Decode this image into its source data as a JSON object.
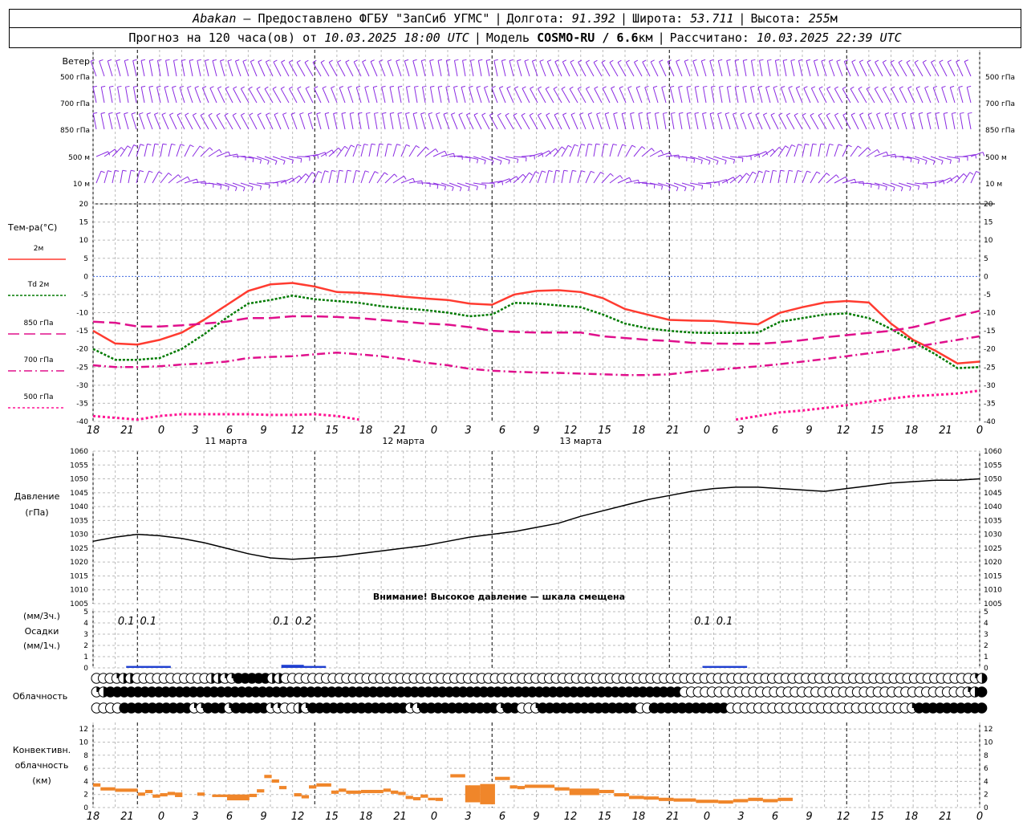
{
  "header": {
    "station": "Abakan",
    "provider": "— Предоставлено ФГБУ \"ЗапСиб УГМС\"",
    "lon_label": "Долгота:",
    "lon": "91.392",
    "lat_label": "Широта:",
    "lat": "53.711",
    "alt_label": "Высота:",
    "alt": "255",
    "alt_unit": "м",
    "forecast_prefix": "Прогноз на 120 часа(ов) от",
    "forecast_start": "10.03.2025 18:00 UTC",
    "model_label": "Модель",
    "model": "COSMO-RU / 6.6",
    "model_unit": "км",
    "computed_label": "Рассчитано:",
    "computed": "10.03.2025 22:39 UTC"
  },
  "wind_panel": {
    "title": "Ветер",
    "levels": [
      "500 гПа",
      "700 гПа",
      "850 гПа",
      "500 м",
      "10  м"
    ],
    "barb_color": "#8a2be2"
  },
  "temp_panel": {
    "title": "Тем-ра(°C)",
    "legend": [
      {
        "label": "2м",
        "color": "#ff3b30",
        "dash": ""
      },
      {
        "label": "Td  2м",
        "color": "#007a00",
        "dash": "3,2"
      },
      {
        "label": "850 гПа",
        "color": "#e0108c",
        "dash": "14,6"
      },
      {
        "label": "700 гПа",
        "color": "#e0108c",
        "dash": "10,4,2,4"
      },
      {
        "label": "500 гПа",
        "color": "#ff1493",
        "dash": "3,3"
      }
    ],
    "y_ticks": [
      "20",
      "15",
      "10",
      "5",
      "0",
      "-5",
      "-10",
      "-15",
      "-20",
      "-25",
      "-30",
      "-35",
      "-40"
    ]
  },
  "x_axis": {
    "hours": [
      "18",
      "21",
      "0",
      "3",
      "6",
      "9",
      "12",
      "15",
      "18",
      "21",
      "0",
      "3",
      "6",
      "9",
      "12",
      "15",
      "18",
      "21",
      "0",
      "3",
      "6",
      "9",
      "12",
      "15",
      "18",
      "21",
      "0"
    ],
    "days": [
      "11 марта",
      "12 марта",
      "13 марта"
    ]
  },
  "pressure_panel": {
    "title": "Давление",
    "unit": "(гПа)",
    "warning": "Внимание! Высокое давление — шкала смещена",
    "y_ticks": [
      "1060",
      "1055",
      "1050",
      "1045",
      "1040",
      "1035",
      "1030",
      "1025",
      "1020",
      "1015",
      "1010",
      "1005"
    ]
  },
  "precip_panel": {
    "unit3": "(мм/3ч.)",
    "title": "Осадки",
    "unit1": "(мм/1ч.)",
    "y_ticks": [
      "5",
      "4",
      "3",
      "2",
      "1",
      "0"
    ],
    "labels": [
      "0.1",
      "0.1",
      "0.1",
      "0.2",
      "0.1",
      "0.1",
      "0.1"
    ]
  },
  "cloud_panel": {
    "title": "Облачность"
  },
  "conv_panel": {
    "title": "Конвективн.",
    "title2": "облачность",
    "unit": "(км)",
    "y_ticks": [
      "12",
      "10",
      "8",
      "6",
      "4",
      "2",
      "0"
    ]
  },
  "chart_data": [
    {
      "type": "line",
      "title": "Тем-ра(°C)",
      "ylim": [
        -40,
        20
      ],
      "x_hours": [
        0,
        3,
        6,
        9,
        12,
        15,
        18,
        21,
        24,
        27,
        30,
        33,
        36,
        39,
        42,
        45,
        48,
        51,
        54,
        57,
        60,
        63,
        66,
        69,
        72,
        75,
        78,
        81,
        84,
        87,
        90,
        93,
        96,
        99,
        102,
        105,
        108,
        111,
        114,
        117,
        120
      ],
      "series": [
        {
          "name": "2м",
          "values": [
            -15,
            -18.5,
            -18.8,
            -17.5,
            -15.5,
            -12,
            -8,
            -4,
            -2.2,
            -1.8,
            -2.8,
            -4.3,
            -4.5,
            -5,
            -5.6,
            -6.1,
            -6.5,
            -7.5,
            -7.8,
            -5,
            -4,
            -3.8,
            -4.3,
            -6,
            -9,
            -10.5,
            -12,
            -12.2,
            -12.3,
            -12.8,
            -13.2,
            -10,
            -8.5,
            -7.2,
            -6.8,
            -7.2,
            -13,
            -17.5,
            -20.5,
            -24,
            -23.5
          ]
        },
        {
          "name": "Td  2м",
          "values": [
            -20,
            -23,
            -23,
            -22.5,
            -20,
            -16,
            -11.5,
            -7.5,
            -6.5,
            -5.3,
            -6.3,
            -6.8,
            -7.3,
            -8.2,
            -8.8,
            -9.3,
            -10,
            -11,
            -10.5,
            -7.3,
            -7.5,
            -8,
            -8.5,
            -10.5,
            -13,
            -14.3,
            -15,
            -15.5,
            -15.6,
            -15.6,
            -15.5,
            -12.5,
            -11.5,
            -10.5,
            -10.2,
            -11.5,
            -14.5,
            -18,
            -21.5,
            -25.3,
            -25
          ]
        },
        {
          "name": "850 гПа",
          "values": [
            -12.5,
            -12.8,
            -13.8,
            -13.8,
            -13.5,
            -13,
            -12.5,
            -11.5,
            -11.5,
            -11,
            -11,
            -11.2,
            -11.5,
            -12,
            -12.5,
            -13,
            -13.3,
            -14,
            -15,
            -15.3,
            -15.5,
            -15.5,
            -15.5,
            -16.5,
            -17,
            -17.5,
            -17.8,
            -18.3,
            -18.5,
            -18.6,
            -18.6,
            -18.2,
            -17.6,
            -16.8,
            -16.2,
            -15.6,
            -15,
            -14,
            -12.5,
            -11,
            -9.5
          ]
        },
        {
          "name": "700 гПа",
          "values": [
            -24.5,
            -25,
            -25,
            -24.8,
            -24.3,
            -24,
            -23.5,
            -22.5,
            -22.2,
            -22,
            -21.5,
            -21,
            -21.5,
            -22,
            -22.8,
            -23.8,
            -24.5,
            -25.5,
            -26,
            -26.3,
            -26.5,
            -26.6,
            -26.8,
            -27,
            -27.2,
            -27.2,
            -27,
            -26.3,
            -25.8,
            -25.3,
            -24.8,
            -24.2,
            -23.5,
            -22.8,
            -22,
            -21.2,
            -20.5,
            -19.5,
            -18.5,
            -17.5,
            -16.5
          ]
        },
        {
          "name": "500 гПа",
          "values": [
            -38.5,
            -39,
            -39.5,
            -38.5,
            -38,
            -38,
            -38,
            -38,
            -38.2,
            -38.2,
            -38,
            -38.5,
            -39.5,
            null,
            null,
            null,
            null,
            null,
            null,
            null,
            null,
            null,
            null,
            null,
            null,
            null,
            null,
            null,
            null,
            -39.5,
            -38.5,
            -37.5,
            -37,
            -36.3,
            -35.5,
            -34.6,
            -33.7,
            -33,
            -32.7,
            -32.3,
            -31.5
          ]
        }
      ]
    },
    {
      "type": "line",
      "title": "Давление",
      "ylabel": "(гПа)",
      "ylim": [
        1005,
        1060
      ],
      "x_hours": [
        0,
        3,
        6,
        9,
        12,
        15,
        18,
        21,
        24,
        27,
        30,
        33,
        36,
        39,
        42,
        45,
        48,
        51,
        54,
        57,
        60,
        63,
        66,
        69,
        72,
        75,
        78,
        81,
        84,
        87,
        90,
        93,
        96,
        99,
        102,
        105,
        108,
        111,
        114,
        117,
        120
      ],
      "series": [
        {
          "name": "Давление",
          "values": [
            1027.5,
            1029,
            1030,
            1029.5,
            1028.5,
            1027,
            1025,
            1023,
            1021.5,
            1021,
            1021.5,
            1022,
            1023,
            1024,
            1025,
            1026,
            1027.5,
            1029,
            1030,
            1031,
            1032.5,
            1034,
            1036.5,
            1038.5,
            1040.5,
            1042.5,
            1044,
            1045.5,
            1046.5,
            1047,
            1047,
            1046.5,
            1046,
            1045.5,
            1046.5,
            1047.5,
            1048.5,
            1049,
            1049.5,
            1049.5,
            1050
          ]
        }
      ]
    },
    {
      "type": "bar",
      "title": "Осадки",
      "ylim": [
        0,
        5
      ],
      "x_hours": [
        6,
        9,
        27,
        30,
        84,
        87
      ],
      "values": [
        0.1,
        0.1,
        0.2,
        0.1,
        0.1,
        0.1
      ]
    },
    {
      "type": "bar",
      "title": "Конвективн. облачность",
      "ylim": [
        0,
        13
      ],
      "segments_km": [
        [
          0,
          1,
          3.2,
          3.7
        ],
        [
          1,
          3,
          2.6,
          3.1
        ],
        [
          3,
          6,
          2.4,
          2.9
        ],
        [
          6,
          7,
          1.8,
          2.3
        ],
        [
          7,
          8,
          2.2,
          2.7
        ],
        [
          8,
          9,
          1.5,
          2.0
        ],
        [
          9,
          10,
          1.7,
          2.2
        ],
        [
          10,
          11,
          1.9,
          2.4
        ],
        [
          11,
          12,
          1.6,
          2.3
        ],
        [
          14,
          15,
          1.8,
          2.3
        ],
        [
          16,
          18,
          1.6,
          2.0
        ],
        [
          18,
          21,
          1.1,
          2.0
        ],
        [
          21,
          22,
          1.6,
          2.1
        ],
        [
          22,
          23,
          2.3,
          2.8
        ],
        [
          23,
          24,
          4.5,
          5.0
        ],
        [
          24,
          25,
          3.8,
          4.3
        ],
        [
          25,
          26,
          2.8,
          3.3
        ],
        [
          27,
          28,
          1.7,
          2.2
        ],
        [
          28,
          29,
          1.4,
          1.9
        ],
        [
          29,
          30,
          2.9,
          3.4
        ],
        [
          30,
          32,
          3.2,
          3.7
        ],
        [
          32,
          33,
          2.1,
          2.6
        ],
        [
          33,
          34,
          2.4,
          2.9
        ],
        [
          34,
          36,
          2.1,
          2.6
        ],
        [
          36,
          39,
          2.2,
          2.7
        ],
        [
          39,
          40,
          2.4,
          2.9
        ],
        [
          40,
          41,
          2.1,
          2.6
        ],
        [
          41,
          42,
          1.9,
          2.4
        ],
        [
          42,
          43,
          1.3,
          1.8
        ],
        [
          43,
          44,
          1.1,
          1.6
        ],
        [
          44,
          45,
          1.5,
          2.0
        ],
        [
          45,
          46,
          1.1,
          1.5
        ],
        [
          46,
          47,
          1.0,
          1.5
        ],
        [
          48,
          50,
          4.6,
          5.1
        ],
        [
          50,
          52,
          0.8,
          3.4
        ],
        [
          52,
          54,
          0.5,
          3.6
        ],
        [
          54,
          56,
          4.2,
          4.7
        ],
        [
          56,
          57,
          2.9,
          3.4
        ],
        [
          57,
          58,
          2.8,
          3.3
        ],
        [
          58,
          62,
          3.0,
          3.5
        ],
        [
          62,
          64,
          2.6,
          3.1
        ],
        [
          64,
          68,
          1.9,
          2.9
        ],
        [
          68,
          70,
          2.2,
          2.7
        ],
        [
          70,
          72,
          1.7,
          2.2
        ],
        [
          72,
          74,
          1.3,
          1.8
        ],
        [
          74,
          76,
          1.2,
          1.7
        ],
        [
          76,
          78,
          1.0,
          1.5
        ],
        [
          78,
          81,
          0.9,
          1.4
        ],
        [
          81,
          84,
          0.7,
          1.2
        ],
        [
          84,
          86,
          0.6,
          1.1
        ],
        [
          86,
          88,
          0.8,
          1.3
        ],
        [
          88,
          90,
          1.0,
          1.5
        ],
        [
          90,
          92,
          0.8,
          1.3
        ],
        [
          92,
          94,
          1.0,
          1.5
        ]
      ]
    }
  ],
  "cloud_rows": {
    "row1": "oooqhhooooooooooohhqqfffffhhooooooooooooooooooooooooooooooooooooooooooooooooooooooooooooooooooooooooooooooooooooooooooooooooooooooqh",
    "row2": "qhfffffffffffffffffffffffffffffffffffffffffffffffffffffffffffffffffffffffffffffffffffoooooooooooooooooooooooooooooooooooooooooqhf",
    "row3": "ooooffffffffffqqfffqfffffqqoohqffffffffffffffqqfffffffffffqffooqffffffffffffffoofffffffffffooooooooooooooooooooooooooqffffffffff"
  }
}
